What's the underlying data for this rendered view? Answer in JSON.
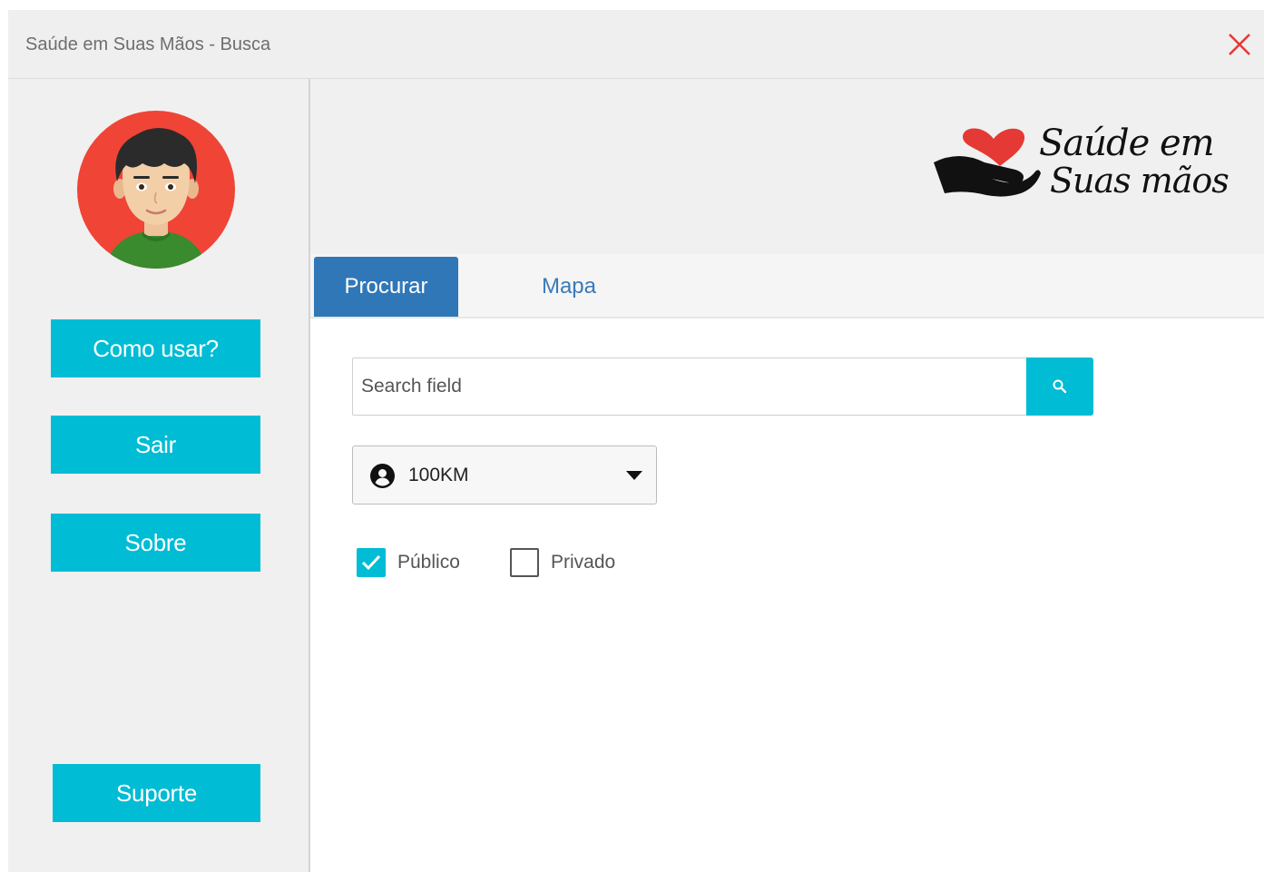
{
  "window": {
    "title": "Saúde em Suas Mãos - Busca"
  },
  "colors": {
    "accent": "#00bcd4",
    "tab_active": "#3077b8",
    "close": "#e53935"
  },
  "sidebar": {
    "buttons": [
      {
        "label": "Como usar?"
      },
      {
        "label": "Sair"
      },
      {
        "label": "Sobre"
      }
    ],
    "support_label": "Suporte"
  },
  "logo": {
    "line1": "Saúde em",
    "line2": "Suas mãos"
  },
  "tabs": [
    {
      "label": "Procurar",
      "active": true
    },
    {
      "label": "Mapa",
      "active": false
    }
  ],
  "search": {
    "placeholder": "Search field",
    "value": "",
    "button_icon": "search-icon"
  },
  "distance": {
    "selected": "100KM",
    "icon": "user-circle-icon"
  },
  "filters": [
    {
      "label": "Público",
      "checked": true
    },
    {
      "label": "Privado",
      "checked": false
    }
  ]
}
